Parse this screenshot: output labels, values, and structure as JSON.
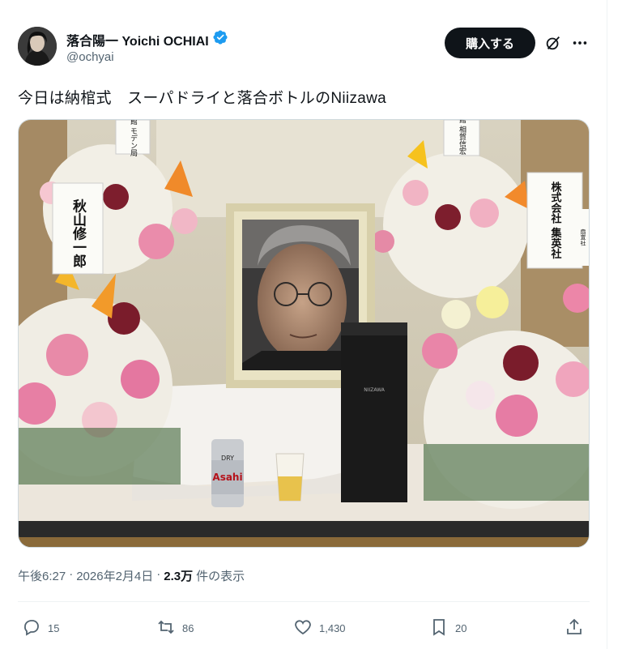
{
  "author": {
    "display_name": "落合陽一 Yoichi OCHIAI",
    "handle": "@ochyai",
    "verified_icon": "verified-badge-icon",
    "verified_color": "#1d9bf0"
  },
  "header": {
    "buy_label": "購入する"
  },
  "tweet": {
    "text": "今日は納棺式　スーパドライと落合ボトルのNiizawa"
  },
  "photo": {
    "placards": {
      "left_top": "小学館 モデン局",
      "left": "秋山修一郎",
      "right_top": "小学館 相賀信宏",
      "right": "株式会社 集英社",
      "far_right": "扇宣社"
    },
    "can_label": "Asahi",
    "can_sub": "DRY"
  },
  "meta": {
    "time": "午後6:27",
    "date": "2026年2月4日",
    "views_count": "2.3万",
    "views_label": "件の表示",
    "separator": "·"
  },
  "actions": {
    "replies": "15",
    "reposts": "86",
    "likes": "1,430",
    "bookmarks": "20"
  }
}
